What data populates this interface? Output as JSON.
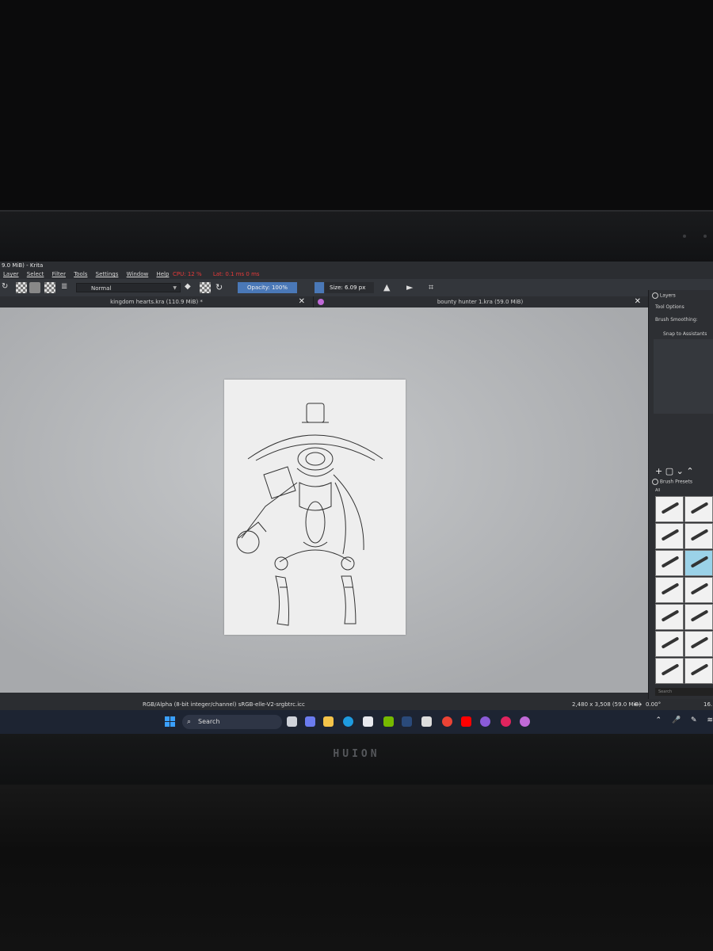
{
  "window": {
    "title": "9.0 MiB) - Krita",
    "menu": [
      "Layer",
      "Select",
      "Filter",
      "Tools",
      "Settings",
      "Window",
      "Help"
    ],
    "stats": [
      "CPU: 12 %",
      "Lat: 0.1 ms 0 ms"
    ]
  },
  "toolbar": {
    "blend_mode": "Normal",
    "opacity": "Opacity: 100%",
    "size": "Size: 6.09 px"
  },
  "tabs": [
    {
      "label": "kingdom hearts.kra (110.9 MiB) *",
      "close": "✕"
    },
    {
      "label": "bounty hunter 1.kra (59.0 MiB)",
      "close": "✕"
    }
  ],
  "dock": {
    "layers": "Layers",
    "tool_options": "Tool Options",
    "brush_smoothing": "Brush Smoothing:",
    "snap": "Snap to Assistants",
    "brush_presets": "Brush Presets",
    "filter": "All",
    "search": "Search"
  },
  "status": {
    "color_space": "RGB/Alpha (8-bit integer/channel)  sRGB-elle-V2-srgbtrc.icc",
    "dimensions": "2,480 x 3,508 (59.0 MiB)",
    "rotation": "0.00°",
    "zoom": "16."
  },
  "taskbar": {
    "search": "Search"
  },
  "device": {
    "brand": "HUION"
  },
  "colors": {
    "accent": "#4a78b7",
    "stats_text": "#e63a3a"
  }
}
